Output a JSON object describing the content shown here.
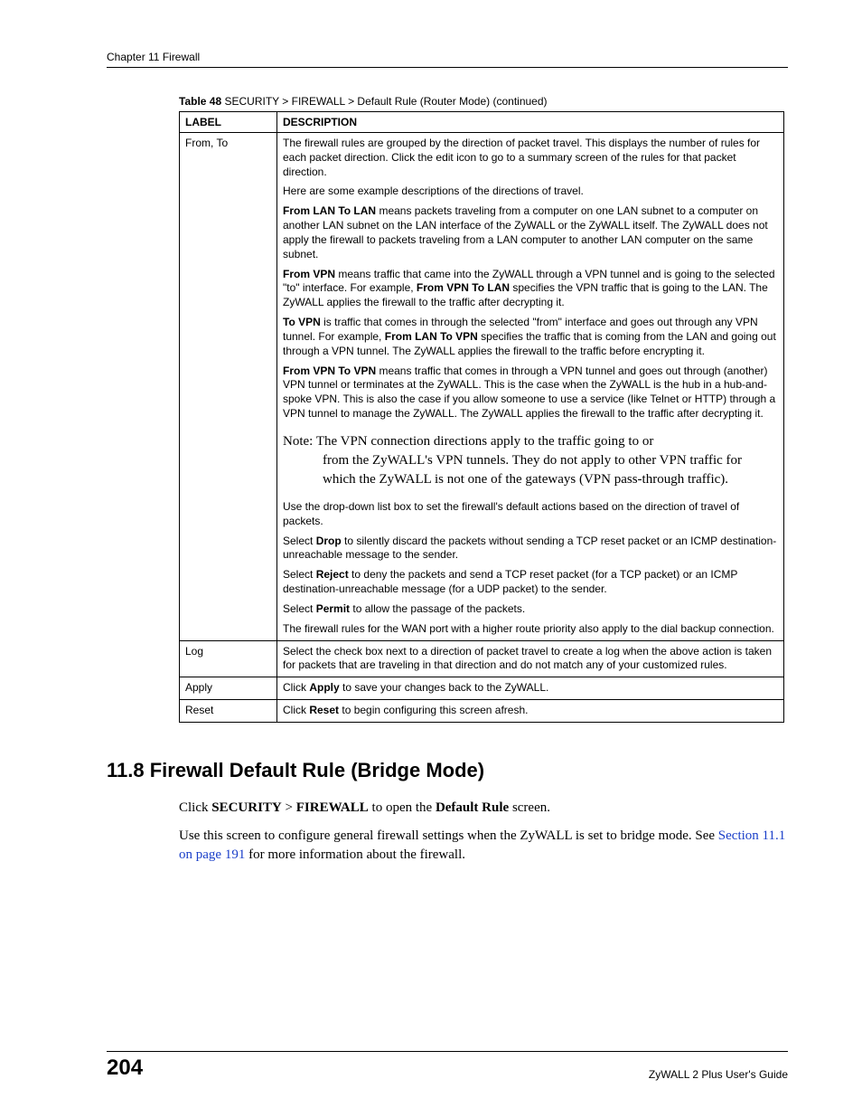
{
  "chapterHeader": "Chapter 11 Firewall",
  "tableCaption": {
    "label": "Table 48",
    "text": "   SECURITY > FIREWALL > Default Rule (Router Mode) (continued)"
  },
  "tableHeaders": {
    "label": "Label",
    "description": "Description"
  },
  "rows": {
    "fromTo": {
      "label": "From, To",
      "p1": "The firewall rules are grouped by the direction of packet travel. This displays the number of rules for each packet direction. Click the edit icon to go to a summary screen of the rules for that packet direction.",
      "p2": "Here are some example descriptions of the directions of travel.",
      "p3a": "From LAN To LAN",
      "p3b": " means packets traveling from a computer on one LAN subnet to a computer on another LAN subnet on the LAN interface of the ZyWALL or the ZyWALL itself. The ZyWALL does not apply the firewall to packets traveling from a LAN computer to another LAN computer on the same subnet.",
      "p4a": "From VPN",
      "p4b": " means traffic that came into the ZyWALL through a VPN tunnel and is going to the selected \"to\" interface. For example, ",
      "p4c": "From VPN To LAN",
      "p4d": " specifies the VPN traffic that is going to the LAN. The ZyWALL applies the firewall to the traffic after decrypting it.",
      "p5a": "To VPN",
      "p5b": " is traffic that comes in through the selected \"from\" interface and goes out through any VPN tunnel. For example, ",
      "p5c": "From LAN To VPN",
      "p5d": " specifies the traffic that is coming from the LAN and going out through a VPN tunnel. The ZyWALL applies the firewall to the traffic before encrypting it.",
      "p6a": "From VPN To VPN",
      "p6b": " means traffic that comes in through a VPN tunnel and goes out through (another) VPN tunnel or terminates at the ZyWALL. This is the case when the ZyWALL is the hub in a hub-and-spoke VPN. This is also the case if you allow someone to use a service (like Telnet or HTTP) through a VPN tunnel to manage the ZyWALL. The ZyWALL applies the firewall to the traffic after decrypting it.",
      "noteLead": "Note: ",
      "noteFirst": "The VPN connection directions apply to the traffic going to or",
      "noteRest": "from the ZyWALL's VPN tunnels. They do not apply to other VPN traffic for which the ZyWALL is not one of the gateways (VPN pass-through traffic).",
      "p7": "Use the drop-down list box to set the firewall's default actions based on the direction of travel of packets.",
      "p8a": "Select ",
      "p8b": "Drop",
      "p8c": " to silently discard the packets without sending a TCP reset packet or an ICMP destination-unreachable message to the sender.",
      "p9a": "Select ",
      "p9b": "Reject",
      "p9c": " to deny the packets and send a TCP reset packet (for a TCP packet) or an ICMP destination-unreachable message (for a UDP packet) to the sender.",
      "p10a": "Select ",
      "p10b": "Permit",
      "p10c": " to allow the passage of the packets.",
      "p11": "The firewall rules for the WAN port with a higher route priority also apply to the dial backup connection."
    },
    "log": {
      "label": "Log",
      "desc": "Select the check box next to a direction of packet travel to create a log when the above action is taken for packets that are traveling in that direction and do not match any of your customized rules."
    },
    "apply": {
      "label": "Apply",
      "a": "Click ",
      "b": "Apply",
      "c": " to save your changes back to the ZyWALL."
    },
    "reset": {
      "label": "Reset",
      "a": "Click ",
      "b": "Reset",
      "c": " to begin configuring this screen afresh."
    }
  },
  "section": {
    "heading": "11.8  Firewall Default Rule (Bridge Mode)",
    "p1a": "Click ",
    "p1b": "SECURITY",
    "p1c": " > ",
    "p1d": "FIREWALL",
    "p1e": " to open the ",
    "p1f": "Default Rule",
    "p1g": " screen.",
    "p2a": "Use this screen to configure general firewall settings when the ZyWALL is set to bridge mode. See ",
    "p2link": "Section 11.1 on page 191",
    "p2b": " for more information about the firewall."
  },
  "footer": {
    "pageNumber": "204",
    "guide": "ZyWALL 2 Plus User's Guide"
  }
}
